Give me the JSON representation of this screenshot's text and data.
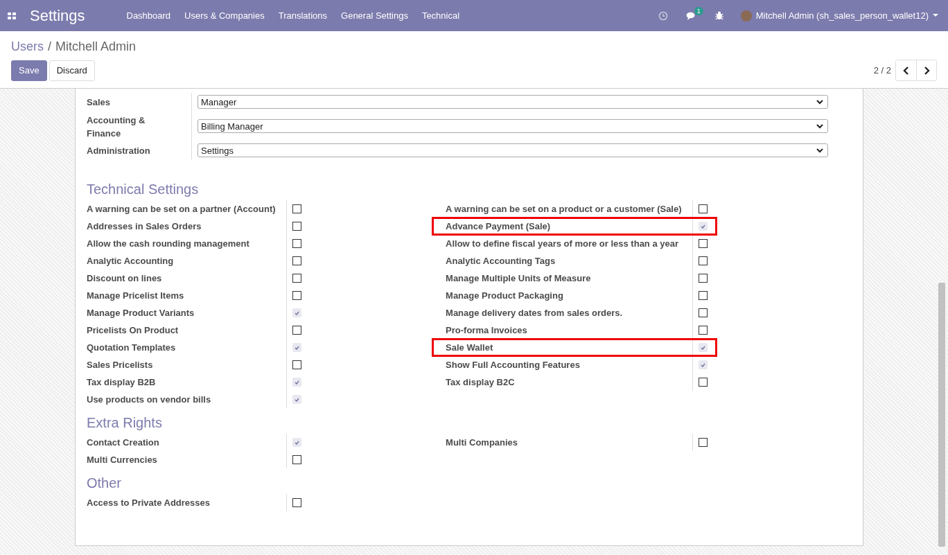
{
  "navbar": {
    "app_title": "Settings",
    "menu": [
      "Dashboard",
      "Users & Companies",
      "Translations",
      "General Settings",
      "Technical"
    ],
    "messages_count": "1",
    "user": "Mitchell Admin (sh_sales_person_wallet12)"
  },
  "breadcrumb": {
    "parent": "Users",
    "separator": "/",
    "current": "Mitchell Admin"
  },
  "buttons": [
    "Save",
    "Discard"
  ],
  "pager": {
    "text": "2 / 2"
  },
  "access_rights": [
    {
      "label": "Sales",
      "value": "Manager"
    },
    {
      "label": "Accounting & Finance",
      "value": "Billing Manager"
    },
    {
      "label": "Administration",
      "value": "Settings"
    }
  ],
  "sections": [
    {
      "title": "Technical Settings",
      "left": [
        {
          "label": "A warning can be set on a partner (Account)",
          "checked": false,
          "highlighted": false
        },
        {
          "label": "Addresses in Sales Orders",
          "checked": false,
          "highlighted": false
        },
        {
          "label": "Allow the cash rounding management",
          "checked": false,
          "highlighted": false
        },
        {
          "label": "Analytic Accounting",
          "checked": false,
          "highlighted": false
        },
        {
          "label": "Discount on lines",
          "checked": false,
          "highlighted": false
        },
        {
          "label": "Manage Pricelist Items",
          "checked": false,
          "highlighted": false
        },
        {
          "label": "Manage Product Variants",
          "checked": true,
          "highlighted": false
        },
        {
          "label": "Pricelists On Product",
          "checked": false,
          "highlighted": false
        },
        {
          "label": "Quotation Templates",
          "checked": true,
          "highlighted": false
        },
        {
          "label": "Sales Pricelists",
          "checked": false,
          "highlighted": false
        },
        {
          "label": "Tax display B2B",
          "checked": true,
          "highlighted": false
        },
        {
          "label": "Use products on vendor bills",
          "checked": true,
          "highlighted": false
        }
      ],
      "right": [
        {
          "label": "A warning can be set on a product or a customer (Sale)",
          "checked": false,
          "highlighted": false
        },
        {
          "label": "Advance Payment (Sale)",
          "checked": true,
          "highlighted": true
        },
        {
          "label": "Allow to define fiscal years of more or less than a year",
          "checked": false,
          "highlighted": false
        },
        {
          "label": "Analytic Accounting Tags",
          "checked": false,
          "highlighted": false
        },
        {
          "label": "Manage Multiple Units of Measure",
          "checked": false,
          "highlighted": false
        },
        {
          "label": "Manage Product Packaging",
          "checked": false,
          "highlighted": false
        },
        {
          "label": "Manage delivery dates from sales orders.",
          "checked": false,
          "highlighted": false
        },
        {
          "label": "Pro-forma Invoices",
          "checked": false,
          "highlighted": false
        },
        {
          "label": "Sale Wallet",
          "checked": true,
          "highlighted": true
        },
        {
          "label": "Show Full Accounting Features",
          "checked": true,
          "highlighted": false
        },
        {
          "label": "Tax display B2C",
          "checked": false,
          "highlighted": false
        }
      ]
    },
    {
      "title": "Extra Rights",
      "left": [
        {
          "label": "Contact Creation",
          "checked": true,
          "highlighted": false
        },
        {
          "label": "Multi Currencies",
          "checked": false,
          "highlighted": false
        }
      ],
      "right": [
        {
          "label": "Multi Companies",
          "checked": false,
          "highlighted": false
        }
      ]
    },
    {
      "title": "Other",
      "left": [
        {
          "label": "Access to Private Addresses",
          "checked": false,
          "highlighted": false
        }
      ]
    }
  ]
}
